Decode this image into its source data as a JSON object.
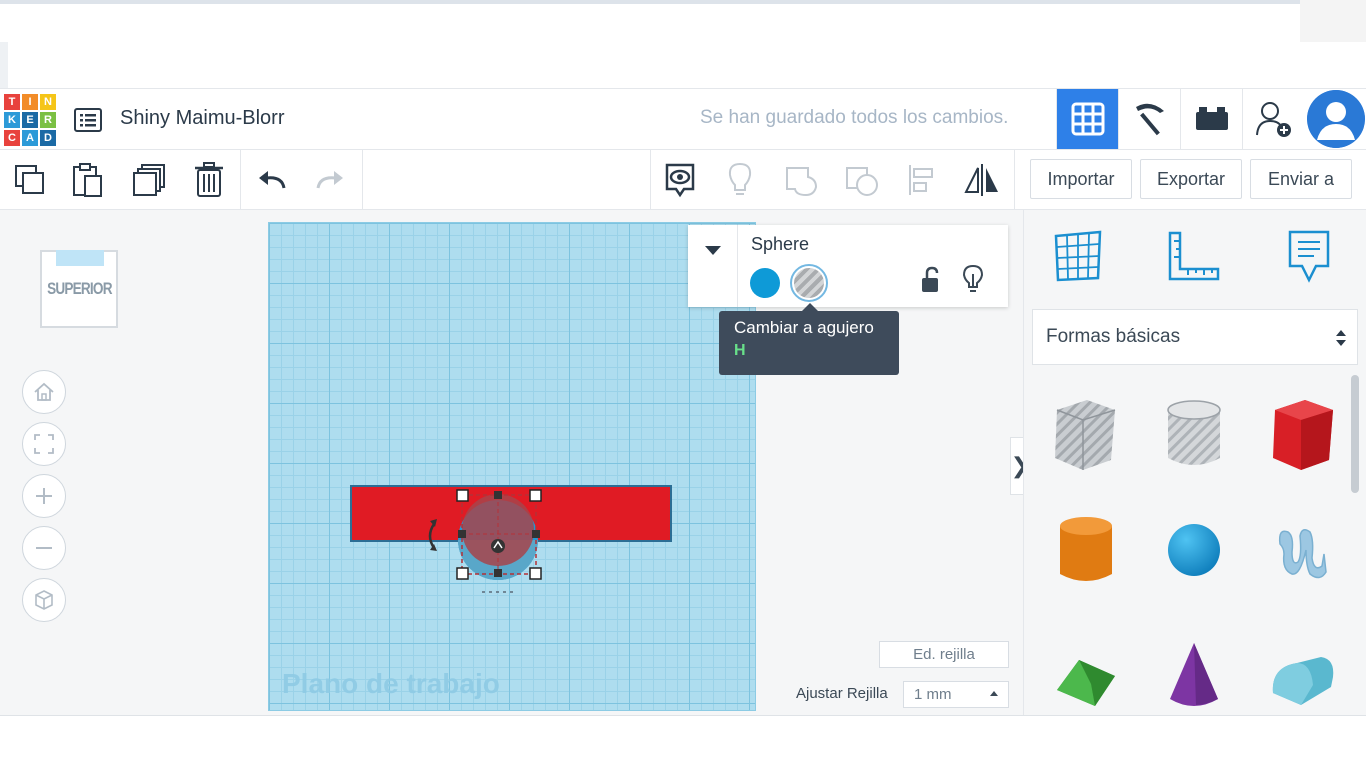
{
  "header": {
    "logo_letters": [
      "T",
      "I",
      "N",
      "K",
      "E",
      "R",
      "C",
      "A",
      "D"
    ],
    "logo_colors": [
      "#e8423d",
      "#f28c28",
      "#f5c518",
      "#2c9ad8",
      "#1b6aa5",
      "#7bc043",
      "#e8423d",
      "#2c9ad8",
      "#1b6aa5"
    ],
    "design_title": "Shiny Maimu-Blorr",
    "save_status": "Se han guardado todos los cambios.",
    "accent": "#2e80e8"
  },
  "toolbar": {
    "import_label": "Importar",
    "export_label": "Exportar",
    "send_label": "Enviar a"
  },
  "viewcube": {
    "label": "SUPERIOR"
  },
  "workplane": {
    "label": "Plano de trabajo",
    "grid_color": "#aeddef"
  },
  "inspector": {
    "shape_name": "Sphere",
    "solid_color": "#0e9ad7"
  },
  "tooltip": {
    "text": "Cambiar a agujero",
    "shortcut": "H"
  },
  "grid_controls": {
    "edit_grid_label": "Ed. rejilla",
    "snap_label": "Ajustar Rejilla",
    "snap_value": "1 mm"
  },
  "shapes_panel": {
    "category": "Formas básicas",
    "shapes": [
      "box-hole-icon",
      "cylinder-hole-icon",
      "box-icon",
      "cylinder-icon",
      "sphere-icon",
      "scribble-icon",
      "roof-icon",
      "cone-icon",
      "round-roof-icon"
    ]
  }
}
